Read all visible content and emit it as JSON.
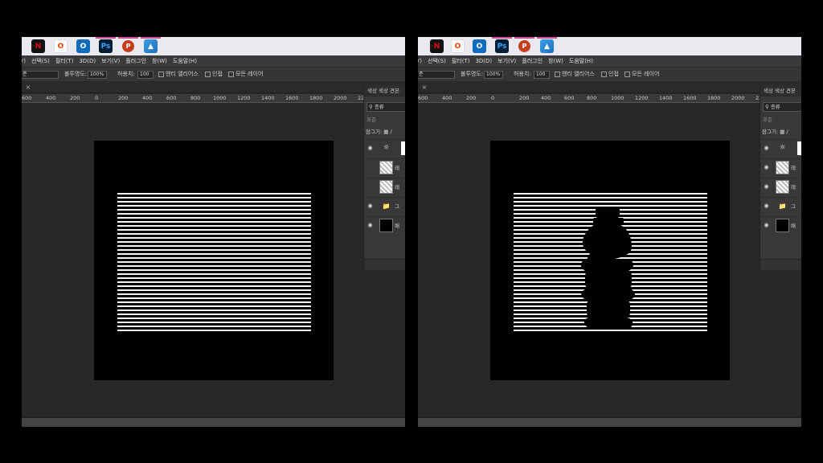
{
  "taskbar_apps": [
    {
      "name": "Netflix",
      "glyph": "N"
    },
    {
      "name": "Office",
      "glyph": "O"
    },
    {
      "name": "Outlook",
      "glyph": "O"
    },
    {
      "name": "Photoshop",
      "glyph": "Ps"
    },
    {
      "name": "PowerPoint",
      "glyph": "P"
    },
    {
      "name": "Photos",
      "glyph": "▲"
    }
  ],
  "menu": [
    "Y)",
    "선택(S)",
    "필터(T)",
    "3D(D)",
    "보기(V)",
    "플러그인",
    "창(W)",
    "도움말(H)"
  ],
  "options": {
    "mode_value": "준",
    "opacity_label": "불투명도:",
    "opacity_value": "100%",
    "tolerance_label": "허용치:",
    "tolerance_value": "100",
    "antialias": "앤티 앨리어스",
    "contiguous": "인접",
    "all_layers": "모든 레이어"
  },
  "document_tab_close": "×",
  "ruler_labels": [
    "600",
    "400",
    "200",
    "0",
    "200",
    "400",
    "600",
    "800",
    "1000",
    "1200",
    "1400",
    "1600",
    "1800",
    "2000",
    "22"
  ],
  "panel": {
    "tabs": "색상 색상 견본",
    "search_placeholder": "종류",
    "blend_mode": "표준",
    "lock_label": "잠그기:",
    "layers": [
      {
        "kind": "adjust",
        "name": ""
      },
      {
        "kind": "image",
        "name": "레"
      },
      {
        "kind": "image",
        "name": "레"
      },
      {
        "kind": "folder",
        "name": "그"
      },
      {
        "kind": "fill",
        "name": "배"
      }
    ]
  },
  "screens": {
    "left": {
      "bottle_visible": false
    },
    "right": {
      "bottle_visible": true
    }
  },
  "colors": {
    "app_bg": "#282828",
    "stripe": "#f4f4f4",
    "accent_pink": "#d4489a"
  }
}
